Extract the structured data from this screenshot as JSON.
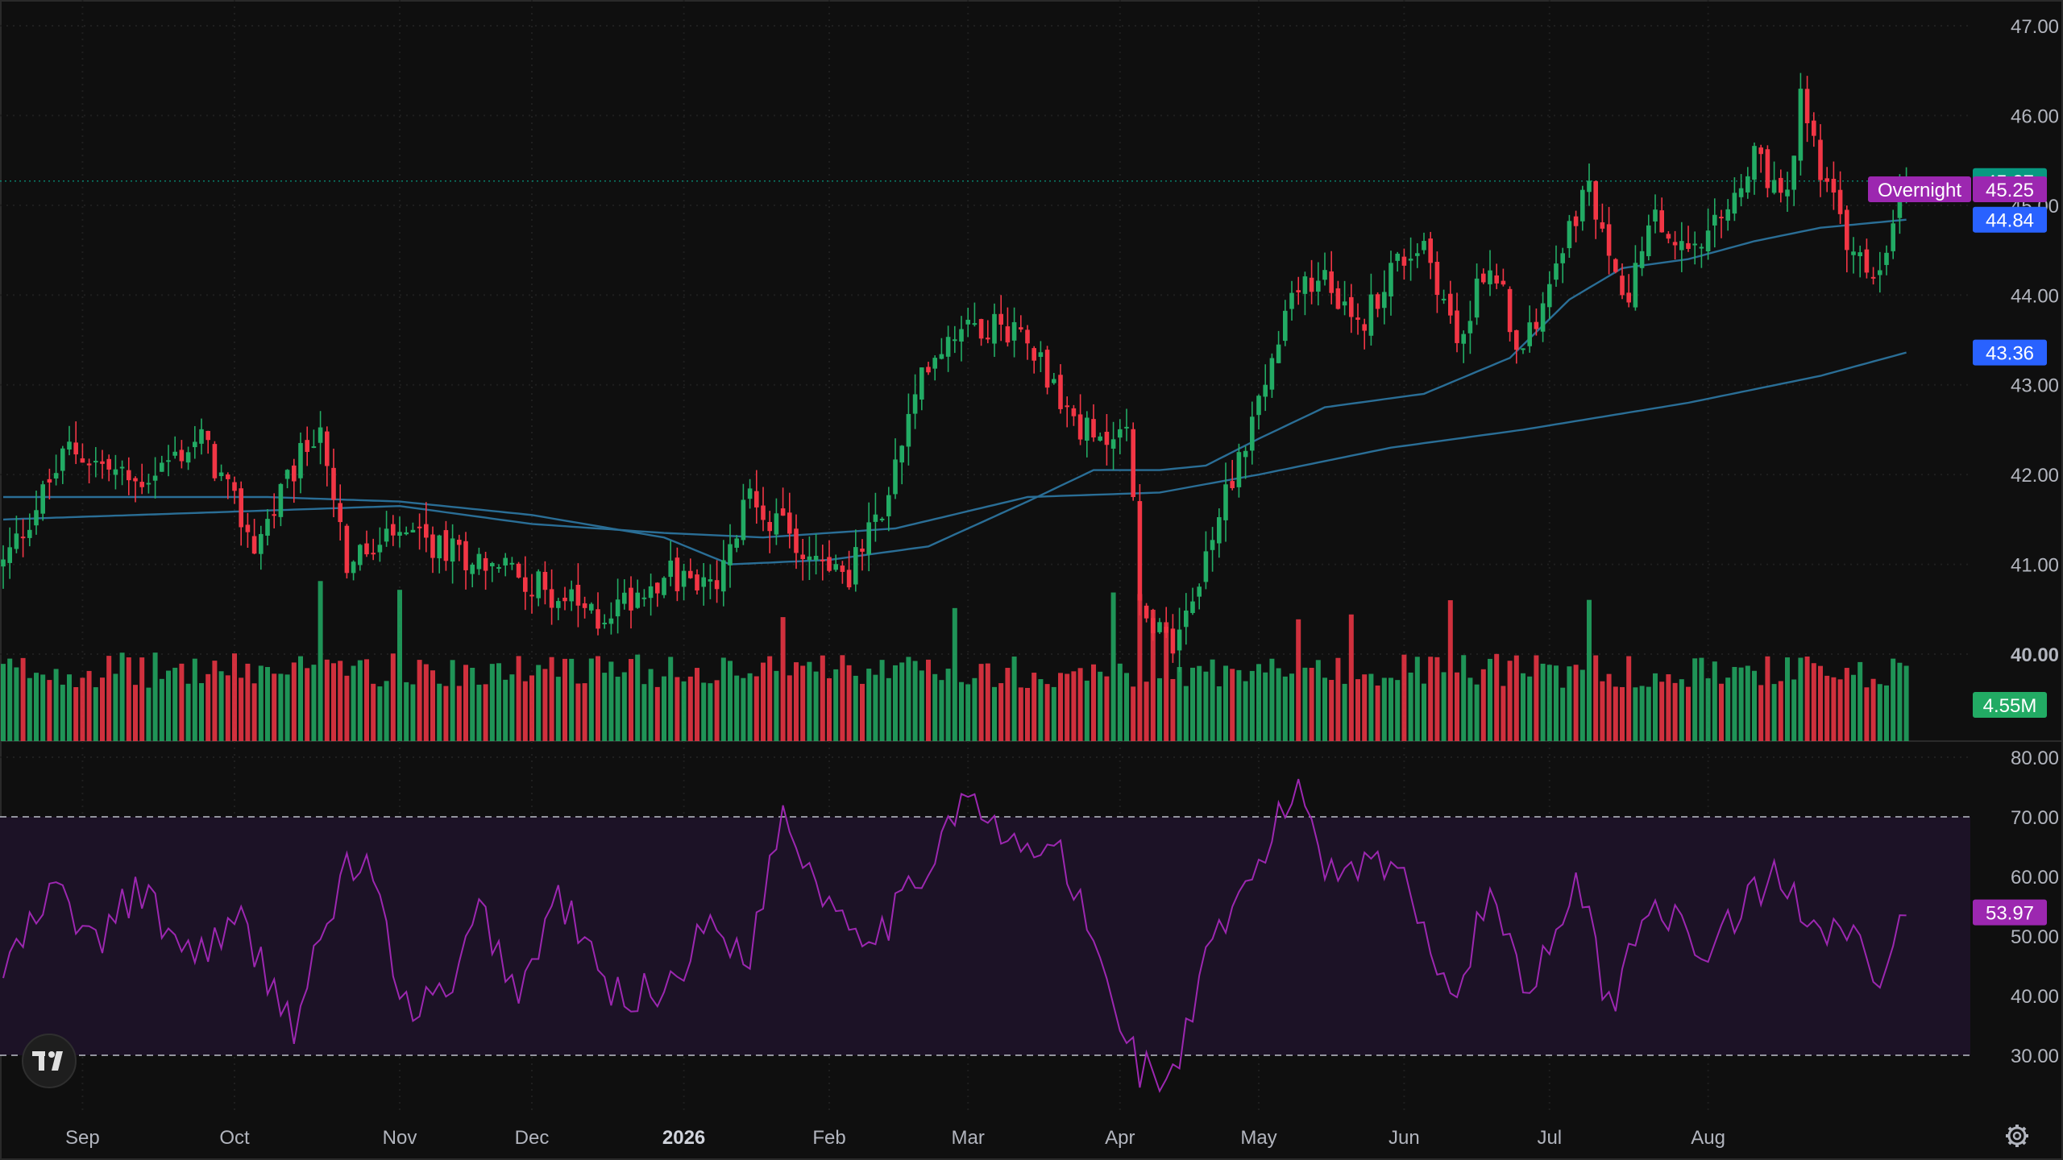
{
  "colors": {
    "background": "#0f0f0f",
    "grid": "#1f1f1f",
    "up": "#22ab64",
    "down": "#f23645",
    "ma_short": "#2a6e96",
    "ma_long": "#2a6e96",
    "rsi_line": "#9c27b0",
    "rsi_band": "#1c1226",
    "text": "#b2b5be",
    "last_price_badge": "#089981",
    "overnight_badge": "#9c27b0",
    "ma_badge": "#2962ff",
    "volume_badge": "#22ab64"
  },
  "badges": {
    "last_price": "45.27",
    "overnight_label": "Overnight",
    "overnight_price": "45.25",
    "ma_short": "44.84",
    "ma_long": "43.36",
    "volume": "4.55M",
    "rsi": "53.97"
  },
  "icons": {
    "logo": "tradingview-logo-icon",
    "settings": "gear-icon"
  },
  "chart_data": {
    "type": "candlestick",
    "x_labels": [
      "Sep",
      "Oct",
      "Nov",
      "Dec",
      "2026",
      "Feb",
      "Mar",
      "Apr",
      "May",
      "Jun",
      "Jul",
      "Aug"
    ],
    "price_axis": {
      "ticks": [
        "47.00",
        "46.00",
        "45.00",
        "44.00",
        "43.00",
        "42.00",
        "41.00",
        "40.00"
      ],
      "ylim": [
        39.5,
        47.3
      ]
    },
    "rsi_axis": {
      "ticks": [
        "80.00",
        "70.00",
        "60.00",
        "50.00",
        "40.00",
        "30.00"
      ],
      "ylim": [
        22,
        82
      ],
      "band": [
        30,
        70
      ]
    },
    "grid": true,
    "price_waypoints": [
      [
        0,
        41.0
      ],
      [
        10,
        42.3
      ],
      [
        20,
        41.9
      ],
      [
        30,
        42.4
      ],
      [
        38,
        41.2
      ],
      [
        48,
        42.6
      ],
      [
        52,
        41.0
      ],
      [
        60,
        41.3
      ],
      [
        75,
        41.0
      ],
      [
        90,
        40.4
      ],
      [
        100,
        40.9
      ],
      [
        108,
        40.7
      ],
      [
        113,
        41.8
      ],
      [
        120,
        41.2
      ],
      [
        128,
        40.9
      ],
      [
        133,
        41.6
      ],
      [
        140,
        43.3
      ],
      [
        145,
        43.7
      ],
      [
        155,
        43.6
      ],
      [
        160,
        42.8
      ],
      [
        166,
        42.3
      ],
      [
        170,
        42.7
      ],
      [
        172,
        40.5
      ],
      [
        178,
        40.1
      ],
      [
        185,
        41.8
      ],
      [
        190,
        42.8
      ],
      [
        195,
        43.9
      ],
      [
        200,
        44.3
      ],
      [
        205,
        43.6
      ],
      [
        210,
        44.3
      ],
      [
        215,
        44.6
      ],
      [
        220,
        43.5
      ],
      [
        225,
        44.4
      ],
      [
        230,
        43.3
      ],
      [
        235,
        44.5
      ],
      [
        240,
        45.2
      ],
      [
        245,
        43.9
      ],
      [
        250,
        44.8
      ],
      [
        255,
        44.4
      ],
      [
        260,
        44.8
      ],
      [
        265,
        45.5
      ],
      [
        270,
        45.0
      ],
      [
        272,
        46.2
      ],
      [
        276,
        45.2
      ],
      [
        280,
        44.4
      ],
      [
        284,
        44.2
      ],
      [
        288,
        45.27
      ]
    ],
    "ma_short": [
      [
        0,
        41.75
      ],
      [
        40,
        41.75
      ],
      [
        60,
        41.7
      ],
      [
        80,
        41.55
      ],
      [
        100,
        41.3
      ],
      [
        110,
        41.0
      ],
      [
        125,
        41.05
      ],
      [
        140,
        41.2
      ],
      [
        155,
        41.7
      ],
      [
        165,
        42.05
      ],
      [
        175,
        42.05
      ],
      [
        182,
        42.1
      ],
      [
        190,
        42.4
      ],
      [
        200,
        42.75
      ],
      [
        215,
        42.9
      ],
      [
        228,
        43.3
      ],
      [
        237,
        43.95
      ],
      [
        245,
        44.3
      ],
      [
        255,
        44.4
      ],
      [
        265,
        44.6
      ],
      [
        275,
        44.75
      ],
      [
        288,
        44.84
      ]
    ],
    "ma_long": [
      [
        0,
        41.5
      ],
      [
        40,
        41.6
      ],
      [
        60,
        41.65
      ],
      [
        80,
        41.45
      ],
      [
        100,
        41.35
      ],
      [
        115,
        41.3
      ],
      [
        135,
        41.4
      ],
      [
        155,
        41.75
      ],
      [
        175,
        41.8
      ],
      [
        190,
        42.0
      ],
      [
        210,
        42.3
      ],
      [
        230,
        42.5
      ],
      [
        255,
        42.8
      ],
      [
        275,
        43.1
      ],
      [
        288,
        43.36
      ]
    ],
    "rsi_waypoints": [
      [
        0,
        44
      ],
      [
        8,
        58
      ],
      [
        14,
        48
      ],
      [
        20,
        58
      ],
      [
        28,
        47
      ],
      [
        36,
        52
      ],
      [
        44,
        35
      ],
      [
        52,
        62
      ],
      [
        56,
        61
      ],
      [
        60,
        38
      ],
      [
        68,
        40
      ],
      [
        72,
        55
      ],
      [
        78,
        40
      ],
      [
        84,
        57
      ],
      [
        92,
        40
      ],
      [
        100,
        41
      ],
      [
        107,
        52
      ],
      [
        113,
        47
      ],
      [
        118,
        71
      ],
      [
        124,
        57
      ],
      [
        132,
        50
      ],
      [
        138,
        58
      ],
      [
        145,
        74
      ],
      [
        152,
        65
      ],
      [
        160,
        64
      ],
      [
        167,
        42
      ],
      [
        172,
        28
      ],
      [
        177,
        26
      ],
      [
        182,
        45
      ],
      [
        190,
        62
      ],
      [
        196,
        76
      ],
      [
        200,
        62
      ],
      [
        210,
        63
      ],
      [
        220,
        40
      ],
      [
        225,
        58
      ],
      [
        231,
        40
      ],
      [
        238,
        61
      ],
      [
        243,
        38
      ],
      [
        250,
        58
      ],
      [
        256,
        46
      ],
      [
        262,
        53
      ],
      [
        268,
        60
      ],
      [
        275,
        52
      ],
      [
        280,
        52
      ],
      [
        284,
        39
      ],
      [
        288,
        53.97
      ]
    ],
    "volume_max_millions": 15
  }
}
